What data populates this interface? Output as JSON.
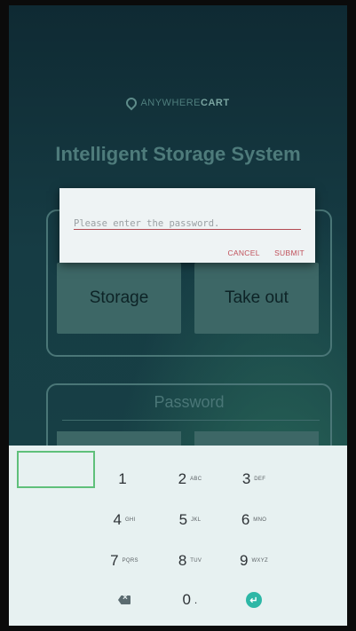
{
  "app": {
    "logo_part1": "ANYWHERE",
    "logo_part2": "CART",
    "title": "Intelligent Storage System",
    "storage_label": "Storage",
    "takeout_label": "Take out",
    "password_section_label": "Password"
  },
  "dialog": {
    "placeholder": "Please enter the password.",
    "value": "",
    "cancel_label": "CANCEL",
    "submit_label": "SUBMIT"
  },
  "keypad": {
    "keys": [
      {
        "digit": "1",
        "letters": ""
      },
      {
        "digit": "2",
        "letters": "ABC"
      },
      {
        "digit": "3",
        "letters": "DEF"
      },
      {
        "digit": "4",
        "letters": "GHI"
      },
      {
        "digit": "5",
        "letters": "JKL"
      },
      {
        "digit": "6",
        "letters": "MNO"
      },
      {
        "digit": "7",
        "letters": "PQRS"
      },
      {
        "digit": "8",
        "letters": "TUV"
      },
      {
        "digit": "9",
        "letters": "WXYZ"
      },
      {
        "digit": "0",
        "letters": "."
      }
    ]
  },
  "colors": {
    "accent": "#c0505a",
    "enter": "#2db7a6",
    "focus": "#5fc07a"
  }
}
